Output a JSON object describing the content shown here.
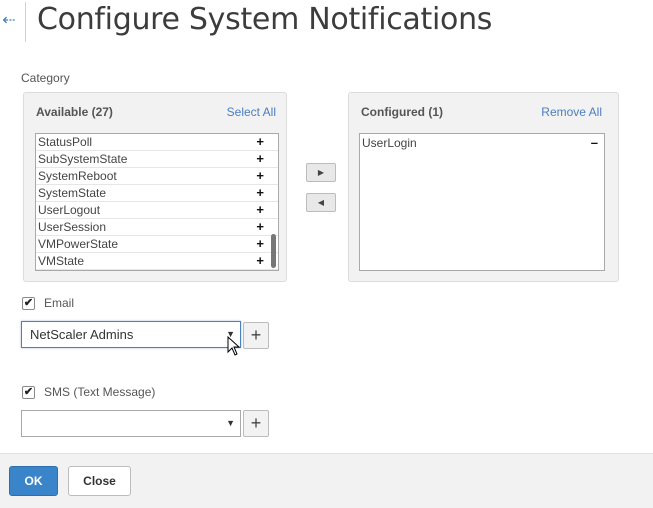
{
  "header": {
    "back_icon": "back-arrow-icon",
    "title": "Configure System Notifications"
  },
  "category": {
    "label": "Category",
    "available": {
      "title": "Available (27)",
      "action_label": "Select All",
      "items": [
        {
          "label": "StatusPoll",
          "action": "+"
        },
        {
          "label": "SubSystemState",
          "action": "+"
        },
        {
          "label": "SystemReboot",
          "action": "+"
        },
        {
          "label": "SystemState",
          "action": "+"
        },
        {
          "label": "UserLogout",
          "action": "+"
        },
        {
          "label": "UserSession",
          "action": "+"
        },
        {
          "label": "VMPowerState",
          "action": "+"
        },
        {
          "label": "VMState",
          "action": "+"
        }
      ]
    },
    "configured": {
      "title": "Configured (1)",
      "action_label": "Remove All",
      "items": [
        {
          "label": "UserLogin",
          "action": "–"
        }
      ]
    },
    "move_right_icon": "▶",
    "move_left_icon": "◀"
  },
  "email": {
    "label": "Email",
    "checked": true,
    "check_mark": "✔",
    "selected": "NetScaler Admins",
    "arrow": "▼",
    "add_label": "+"
  },
  "sms": {
    "label": "SMS (Text Message)",
    "checked": true,
    "check_mark": "✔",
    "selected": "",
    "arrow": "▼",
    "add_label": "+"
  },
  "footer": {
    "ok_label": "OK",
    "close_label": "Close"
  },
  "colors": {
    "accent": "#4a7fc1",
    "primary_button": "#3a84c9"
  }
}
